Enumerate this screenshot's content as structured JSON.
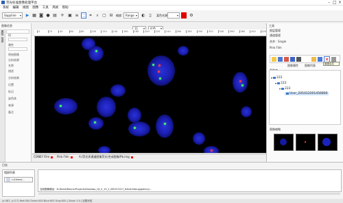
{
  "app": {
    "title": "荧光标准图像处理平台"
  },
  "menu": [
    "系统",
    "编辑",
    "视图",
    "图像",
    "工具",
    "风格",
    "帮助"
  ],
  "toolbar": {
    "mode_select": "Sapphire",
    "zoom_label": "缩放：",
    "zoom_value": "Range",
    "intensity_label": "强度",
    "intensity_value": "11",
    "color_label": "颜色",
    "color_value": "红色",
    "channel_label": "某色光源",
    "accent": "#e00000"
  },
  "left_panel": {
    "title": "图像信息",
    "tabs": [
      "属性",
      "信息"
    ],
    "fields": [
      "ID",
      "属性",
      "原始图像",
      "分析结果",
      "名称",
      "描述",
      "分析结果",
      "位置",
      "标记",
      "染色体",
      "来源",
      "备注"
    ]
  },
  "ruler": {
    "marks": [
      "0",
      "20",
      "40",
      "60",
      "80",
      "100",
      "120",
      "140",
      "160",
      "180",
      "200",
      "220",
      "240",
      "260",
      "280",
      "300",
      "320",
      "340",
      "360",
      "380",
      "400",
      "420"
    ]
  },
  "doc_tabs": [
    {
      "label": "CONEY Film"
    },
    {
      "label": "Pink Film"
    },
    {
      "label": "A:/荧光多通道图像荧光/合成图像/Pb.img"
    }
  ],
  "right_panel": {
    "title": "工具",
    "items": [
      "图层管理",
      "通道管理",
      "合并：Single",
      "Pink Film"
    ],
    "tabs": [
      "图像属性",
      "图像列表"
    ],
    "tooltip": "组图合并",
    "tree_label": "图像库",
    "tree": [
      "222",
      "222",
      "222",
      "User_201012201456800"
    ],
    "thumbs_label": "图像缩略"
  },
  "log_panel": {
    "title": "日志",
    "list_title": "相册列表",
    "list_item": "c:/Users/...",
    "message": "当前图像路径：D:/Build/BannerProjects/Desktop_Qt_5_15_2_MSVC2017_64bit-Debug/gallery/..."
  },
  "status": {
    "text": "(x:587, y:117)  Red:000 Green:000 Blue:003 Gray:000 | Zoom 1:0 | 加载完成"
  }
}
